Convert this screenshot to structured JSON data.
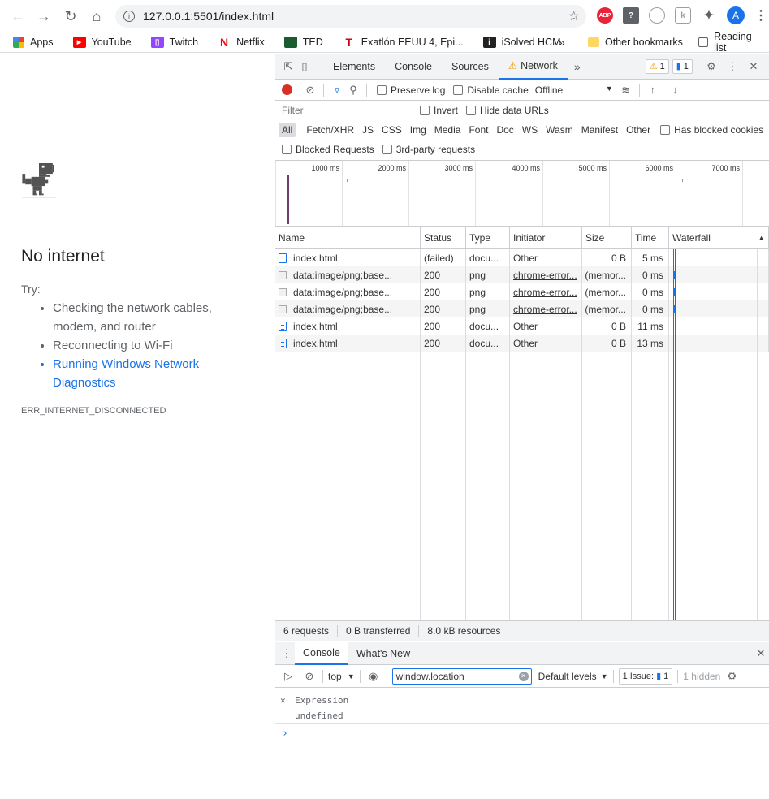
{
  "browser": {
    "url": "127.0.0.1:5501/index.html",
    "profile_initial": "A",
    "extensions": [
      "ABP",
      "?",
      "",
      "k"
    ]
  },
  "bookmarks": [
    {
      "label": "Apps",
      "icon": "apps-grid-icon",
      "color": "#4285f4"
    },
    {
      "label": "YouTube",
      "icon": "youtube-icon",
      "color": "#ff0000"
    },
    {
      "label": "Twitch",
      "icon": "twitch-icon",
      "color": "#9146ff"
    },
    {
      "label": "Netflix",
      "icon": "netflix-icon",
      "color": "#e50914"
    },
    {
      "label": "TED",
      "icon": "ted-icon",
      "color": "#1a5c2e"
    },
    {
      "label": "Exatlón EEUU 4, Epi...",
      "icon": "telemundo-icon",
      "color": "#d0021b"
    },
    {
      "label": "iSolved HCM",
      "icon": "isolved-icon",
      "color": "#222222"
    }
  ],
  "bookmarks_overflow": "»",
  "other_bookmarks": "Other bookmarks",
  "reading_list": "Reading list",
  "page": {
    "title": "No internet",
    "try": "Try:",
    "tips": [
      "Checking the network cables, modem, and router",
      "Reconnecting to Wi-Fi"
    ],
    "tip_link": "Running Windows Network Diagnostics",
    "error_code": "ERR_INTERNET_DISCONNECTED"
  },
  "devtools": {
    "tabs": [
      "Elements",
      "Console",
      "Sources",
      "Network"
    ],
    "active_tab": "Network",
    "more": "»",
    "warnings": "1",
    "messages": "1",
    "network_toolbar": {
      "preserve_log": "Preserve log",
      "disable_cache": "Disable cache",
      "throttling": "Offline"
    },
    "filter": {
      "placeholder": "Filter",
      "invert": "Invert",
      "hide_data_urls": "Hide data URLs"
    },
    "types": [
      "All",
      "Fetch/XHR",
      "JS",
      "CSS",
      "Img",
      "Media",
      "Font",
      "Doc",
      "WS",
      "Wasm",
      "Manifest",
      "Other"
    ],
    "active_type": "All",
    "has_blocked_cookies": "Has blocked cookies",
    "blocked_requests": "Blocked Requests",
    "third_party": "3rd-party requests",
    "overview_ticks": [
      "1000 ms",
      "2000 ms",
      "3000 ms",
      "4000 ms",
      "5000 ms",
      "6000 ms",
      "7000 ms"
    ],
    "columns": [
      "Name",
      "Status",
      "Type",
      "Initiator",
      "Size",
      "Time",
      "Waterfall"
    ],
    "rows": [
      {
        "name": "index.html",
        "status": "(failed)",
        "type": "docu...",
        "initiator": "Other",
        "size": "0 B",
        "time": "5 ms",
        "icon": "doc"
      },
      {
        "name": "data:image/png;base...",
        "status": "200",
        "type": "png",
        "initiator": "chrome-error...",
        "size": "(memor...",
        "time": "0 ms",
        "icon": "img"
      },
      {
        "name": "data:image/png;base...",
        "status": "200",
        "type": "png",
        "initiator": "chrome-error...",
        "size": "(memor...",
        "time": "0 ms",
        "icon": "img"
      },
      {
        "name": "data:image/png;base...",
        "status": "200",
        "type": "png",
        "initiator": "chrome-error...",
        "size": "(memor...",
        "time": "0 ms",
        "icon": "img"
      },
      {
        "name": "index.html",
        "status": "200",
        "type": "docu...",
        "initiator": "Other",
        "size": "0 B",
        "time": "11 ms",
        "icon": "doc"
      },
      {
        "name": "index.html",
        "status": "200",
        "type": "docu...",
        "initiator": "Other",
        "size": "0 B",
        "time": "13 ms",
        "icon": "doc"
      }
    ],
    "summary": [
      "6 requests",
      "0 B transferred",
      "8.0 kB resources"
    ],
    "drawer_tabs": [
      "Console",
      "What's New"
    ],
    "console": {
      "context": "top",
      "expression_input": "window.location",
      "levels": "Default levels",
      "issues": "1 Issue:",
      "issues_count": "1",
      "hidden": "1 hidden",
      "expression_label": "Expression",
      "expression_result": "undefined"
    }
  }
}
